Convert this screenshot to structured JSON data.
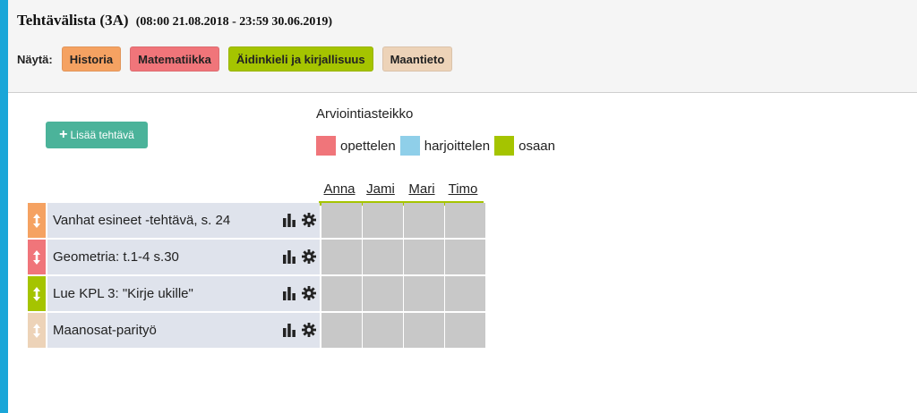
{
  "header": {
    "title": "Tehtävälista (3A)",
    "date_range": "(08:00 21.08.2018 - 23:59 30.06.2019)"
  },
  "filter": {
    "label": "Näytä:",
    "subjects": [
      {
        "label": "Historia",
        "color": "#f5a262"
      },
      {
        "label": "Matematiikka",
        "color": "#f0757a"
      },
      {
        "label": "Äidinkieli ja kirjallisuus",
        "color": "#a5c400"
      },
      {
        "label": "Maantieto",
        "color": "#edd3b8"
      }
    ]
  },
  "add_task": {
    "label": "Lisää tehtävä",
    "icon": "plus-icon",
    "color": "#4bb39a"
  },
  "scale": {
    "title": "Arviointiasteikko",
    "levels": [
      {
        "label": "opettelen",
        "color": "#f0757a"
      },
      {
        "label": "harjoittelen",
        "color": "#8fcfe9"
      },
      {
        "label": "osaan",
        "color": "#a5c400"
      }
    ]
  },
  "students": [
    "Anna",
    "Jami",
    "Mari",
    "Timo"
  ],
  "tasks": [
    {
      "label": "Vanhat esineet -tehtävä, s. 24",
      "color": "#f5a262"
    },
    {
      "label": "Geometria: t.1-4 s.30",
      "color": "#f0757a"
    },
    {
      "label": "Lue KPL 3: \"Kirje ukille\"",
      "color": "#a5c400"
    },
    {
      "label": "Maanosat-parityö",
      "color": "#edd3b8"
    }
  ],
  "colors": {
    "sidebar_accent": "#1aa6d8",
    "empty_cell": "#c8c8c8",
    "task_background": "#dfe3ec"
  }
}
